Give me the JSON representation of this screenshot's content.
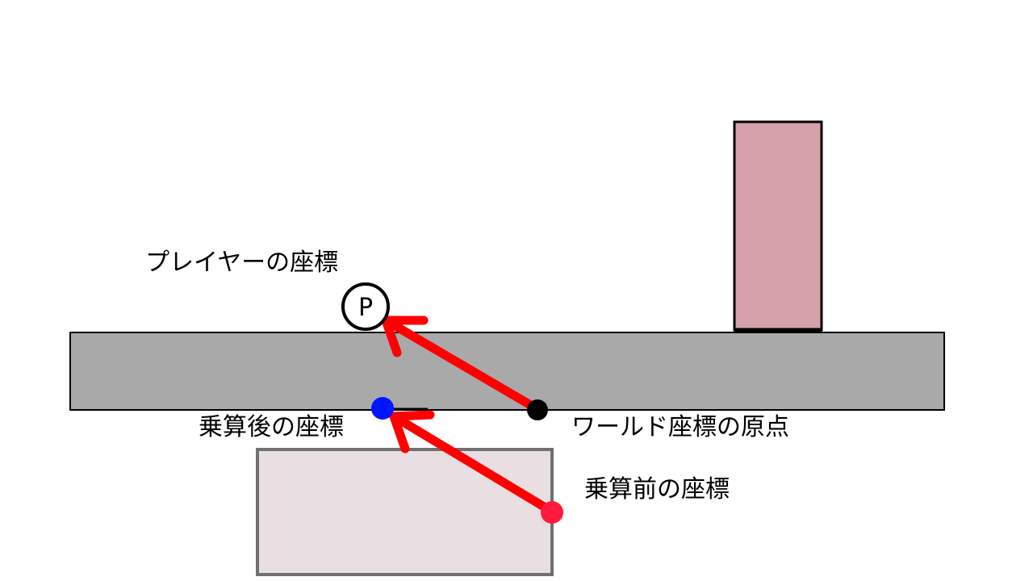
{
  "labels": {
    "player_coords": "プレイヤーの座標",
    "after_multiply": "乗算後の座標",
    "world_origin": "ワールド座標の原点",
    "before_multiply": "乗算前の座標"
  },
  "player_marker": {
    "letter": "P"
  },
  "colors": {
    "arrow": "#ff0000",
    "floor": "#a9a9a9",
    "pillar": "#d4a1a8",
    "box": "#e9dfe2",
    "origin_point": "#000000",
    "after_point": "#0015ff",
    "before_point": "#ff1a3c"
  }
}
